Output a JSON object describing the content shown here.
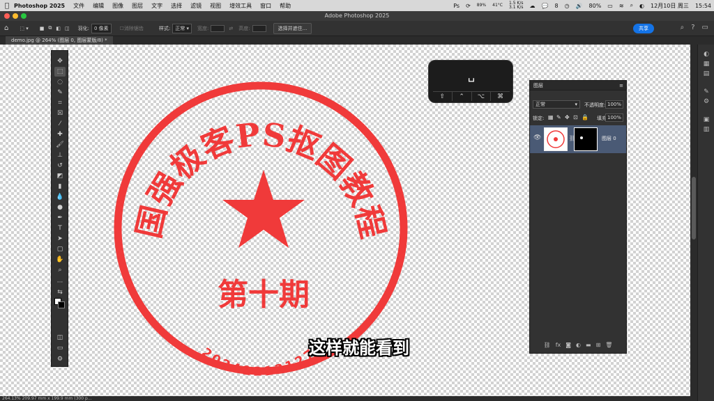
{
  "menubar": {
    "apple_icon": "apple-icon",
    "app_name": "Photoshop 2025",
    "menus": [
      "文件",
      "编辑",
      "图像",
      "图层",
      "文字",
      "选择",
      "滤镜",
      "视图",
      "增效工具",
      "窗口",
      "帮助"
    ],
    "battery_stat": "89%",
    "battery_sub": "",
    "temp": "41°C",
    "temp_sub": "",
    "net_up": "1.5 K/s",
    "net_down": "3.1 K/s",
    "wechat_badge": "8",
    "battery_percent": "80%",
    "date_time": "12月10日 周三",
    "clock": "15:54"
  },
  "window": {
    "title": "Adobe Photoshop 2025",
    "traffic_colors": [
      "#ff5f57",
      "#febc2e",
      "#28c840"
    ]
  },
  "options_bar": {
    "feather_label": "羽化:",
    "feather_value": "0 像素",
    "antialias_label": "消除锯齿",
    "style_label": "样式:",
    "style_value": "正常",
    "width_label": "宽度:",
    "height_label": "高度:",
    "select_mask_button": "选择并遮住...",
    "share_button": "共享"
  },
  "document": {
    "tab_label": "demo.jpg @ 264% (图层 0, 图层蒙版/8) *",
    "status": "264.13%   209.97 mm x 199.9 mm (300 p..."
  },
  "stamp": {
    "arc_text": "国强极客PS抠图教程",
    "center_text": "第十期",
    "number_text": "20241213127",
    "color": "#f03a3a"
  },
  "keyboard_overlay": {
    "space_glyph": "␣",
    "keys": [
      "⇧",
      "⌃",
      "⌥",
      "⌘"
    ]
  },
  "layers_panel": {
    "title": "图层",
    "blend_mode": "正常",
    "opacity_label": "不透明度:",
    "opacity_value": "100%",
    "lock_label": "锁定:",
    "fill_label": "填充:",
    "fill_value": "100%",
    "layer_name": "图层 0"
  },
  "subtitle": "这样就能看到"
}
